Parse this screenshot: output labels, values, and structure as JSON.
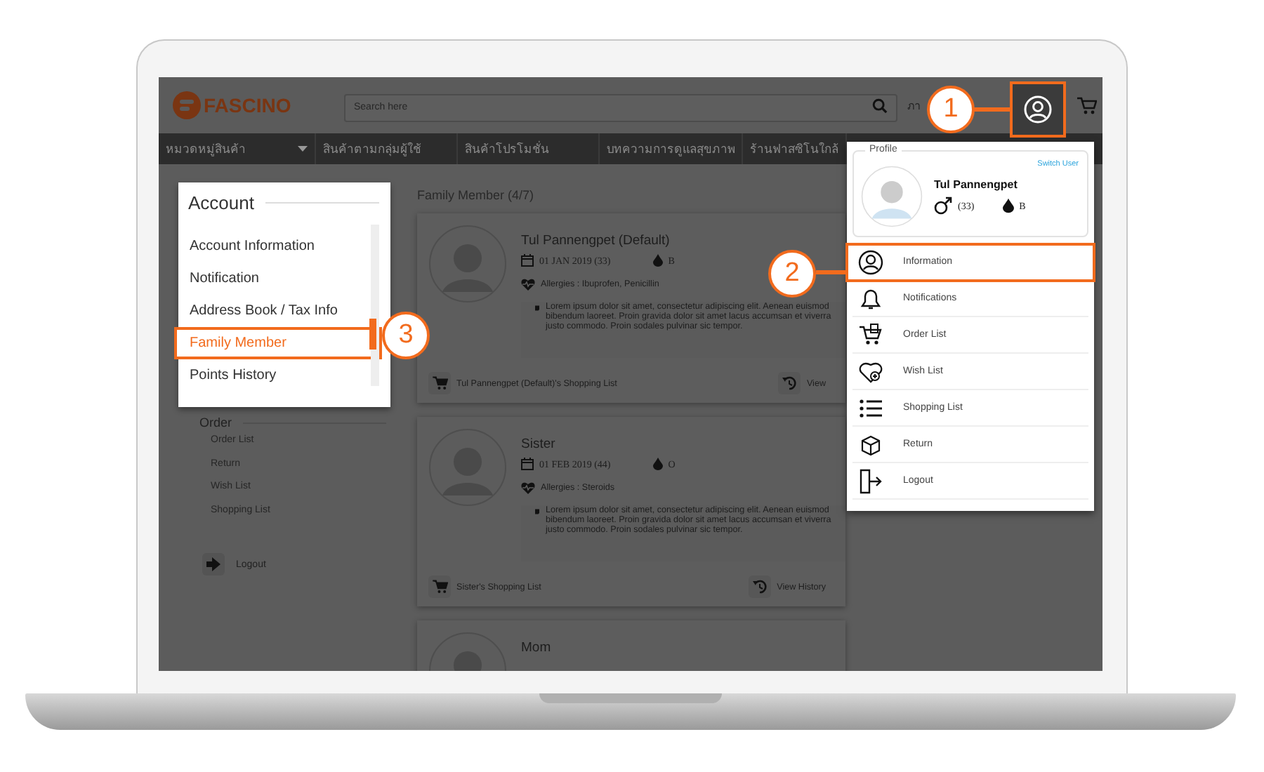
{
  "header": {
    "logo": "FASCINO",
    "search_placeholder": "Search here",
    "language": "ภา"
  },
  "nav": [
    {
      "label": "หมวดหมู่สินค้า",
      "has_dropdown": true
    },
    {
      "label": "สินค้าตามกลุ่มผู้ใช้",
      "has_dropdown": false
    },
    {
      "label": "สินค้าโปรโมชั่น",
      "has_dropdown": false
    },
    {
      "label": "บทความการดูแลสุขภาพ",
      "has_dropdown": false
    },
    {
      "label": "ร้านฟาสซิโนใกล้",
      "has_dropdown": false
    }
  ],
  "account_menu": {
    "title": "Account",
    "items": [
      {
        "label": "Account Information",
        "selected": false
      },
      {
        "label": "Notification",
        "selected": false
      },
      {
        "label": "Address Book / Tax Info",
        "selected": false
      },
      {
        "label": "Family Member",
        "selected": true
      },
      {
        "label": "Points History",
        "selected": false
      }
    ]
  },
  "order_menu": {
    "title": "Order",
    "items": [
      "Order List",
      "Return",
      "Wish List",
      "Shopping List"
    ]
  },
  "logout": "Logout",
  "main": {
    "title": "Family Member (4/7)",
    "members": [
      {
        "name": "Tul Pannengpet (Default)",
        "birth": "01 JAN 2019 (33)",
        "blood": "B",
        "allergies": "Allergies : Ibuprofen, Penicillin",
        "note": "Lorem ipsum dolor sit amet, consectetur adipiscing elit. Aenean euismod bibendum laoreet. Proin gravida dolor sit amet lacus accumsan et viverra justo commodo. Proin sodales pulvinar sic tempor.",
        "shopping_list": "Tul Pannengpet (Default)'s Shopping List",
        "history": "View"
      },
      {
        "name": "Sister",
        "birth": "01 FEB 2019 (44)",
        "blood": "O",
        "allergies": "Allergies : Steroids",
        "note": "Lorem ipsum dolor sit amet, consectetur adipiscing elit. Aenean euismod bibendum laoreet. Proin gravida dolor sit amet lacus accumsan et viverra justo commodo. Proin sodales pulvinar sic tempor.",
        "shopping_list": "Sister's Shopping List",
        "history": "View History"
      },
      {
        "name": "Mom"
      }
    ]
  },
  "profile_menu": {
    "label": "Profile",
    "switch_user": "Switch User",
    "name": "Tul Pannengpet",
    "age": "(33)",
    "blood": "B",
    "items": [
      {
        "kind": "information",
        "label": "Information",
        "selected": true
      },
      {
        "kind": "notifications",
        "label": "Notifications",
        "selected": false
      },
      {
        "kind": "orders",
        "label": "Order List",
        "selected": false
      },
      {
        "kind": "wishlist",
        "label": "Wish List",
        "selected": false
      },
      {
        "kind": "shopping",
        "label": "Shopping List",
        "selected": false
      },
      {
        "kind": "return",
        "label": "Return",
        "selected": false
      },
      {
        "kind": "logout",
        "label": "Logout",
        "selected": false
      }
    ]
  },
  "callouts": [
    "1",
    "2",
    "3"
  ]
}
